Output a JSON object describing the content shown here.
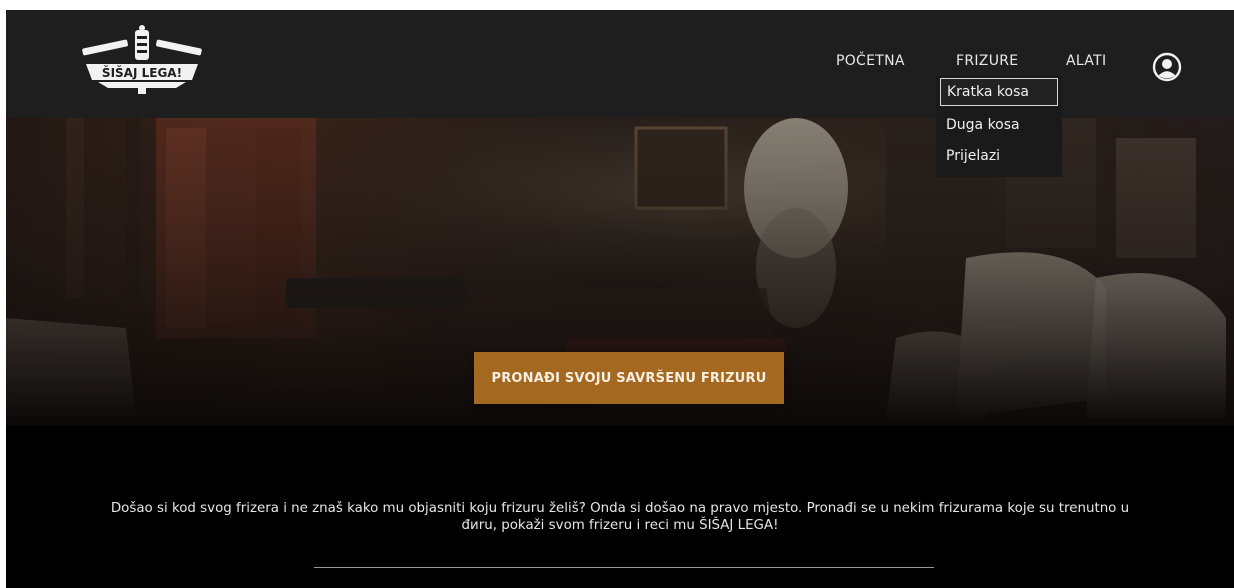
{
  "brand": {
    "logo_text": "ŠIŠAJ LEGA!"
  },
  "nav": {
    "items": [
      "POČETNA",
      "FRIZURE",
      "ALATI"
    ],
    "profile_icon": "user-circle-icon"
  },
  "dropdown": {
    "items": [
      "Kratka kosa",
      "Duga kosa",
      "Prijelazi"
    ]
  },
  "hero": {
    "cta_label": "PRONAĐI SVOJU SAVRŠENU FRIZURU"
  },
  "intro": {
    "text": "Došao si kod svog frizera i ne znaš kako mu objasniti koju frizuru želiš? Onda si došao na pravo mjesto. Pronađi se u nekim frizurama koje su trenutno u đиru, pokaži svom frizeru i reci mu ŠIŠAJ LEGA!"
  },
  "colors": {
    "header_bg": "#1e1e1e",
    "cta_bg": "#a56820",
    "page_bg": "#000000"
  }
}
